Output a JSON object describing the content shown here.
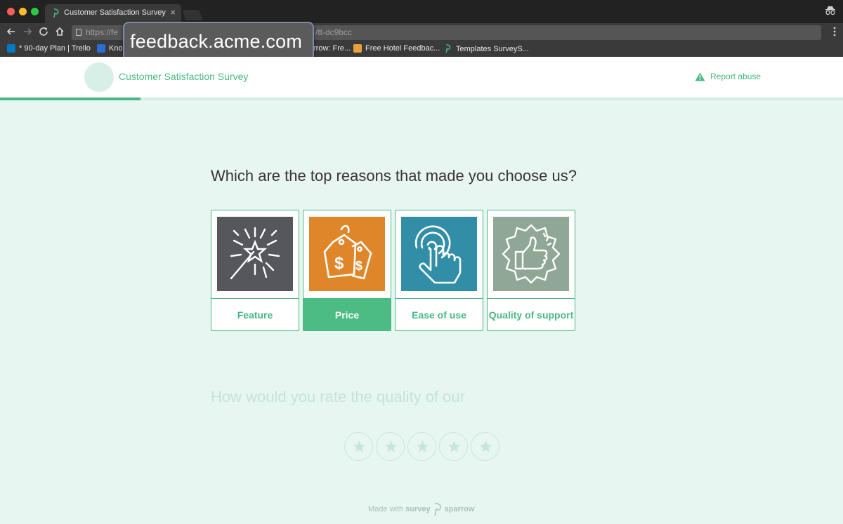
{
  "browser": {
    "tab_title": "Customer Satisfaction Survey",
    "tab_close": "×",
    "url_prefix": "https://fe",
    "url_suffix": "/tt-dc9bcc",
    "url_overlay": "feedback.acme.com",
    "bookmarks": [
      {
        "label": "* 90-day Plan | Trello",
        "icon": "trello-icon",
        "color": "#0079bf"
      },
      {
        "label": "Kno",
        "icon": "bookmark-icon",
        "color": "#2b6cd6"
      },
      {
        "label": "rrow: Fre...",
        "icon": "bookmark-icon",
        "color": "#3a3a3b"
      },
      {
        "label": "Free Hotel Feedbac...",
        "icon": "survey-icon",
        "color": "#e9a23b"
      },
      {
        "label": "Templates SurveyS...",
        "icon": "sparrow-icon",
        "color": "#49b883"
      }
    ]
  },
  "header": {
    "title": "Customer Satisfaction Survey",
    "report_label": "Report abuse"
  },
  "progress": {
    "fraction": 0.1667
  },
  "question": {
    "text": "Which are the top reasons that made you choose us?",
    "options": [
      {
        "label": "Feature",
        "icon": "sparkle-wand-icon",
        "bg": "#55575d",
        "selected": false
      },
      {
        "label": "Price",
        "icon": "price-tag-icon",
        "bg": "#e0862a",
        "selected": true
      },
      {
        "label": "Ease of use",
        "icon": "tap-hand-icon",
        "bg": "#318ea6",
        "selected": false
      },
      {
        "label": "Quality of support",
        "icon": "thumbs-up-badge-icon",
        "bg": "#8fa794",
        "selected": false
      }
    ]
  },
  "next_question": {
    "text": "How would you rate the quality of our",
    "stars": 5
  },
  "footer": {
    "made_with": "Made with",
    "brand_survey": "survey",
    "brand_sparrow": "sparrow"
  },
  "colors": {
    "accent": "#49b883",
    "page_bg": "#e7f6f0"
  }
}
